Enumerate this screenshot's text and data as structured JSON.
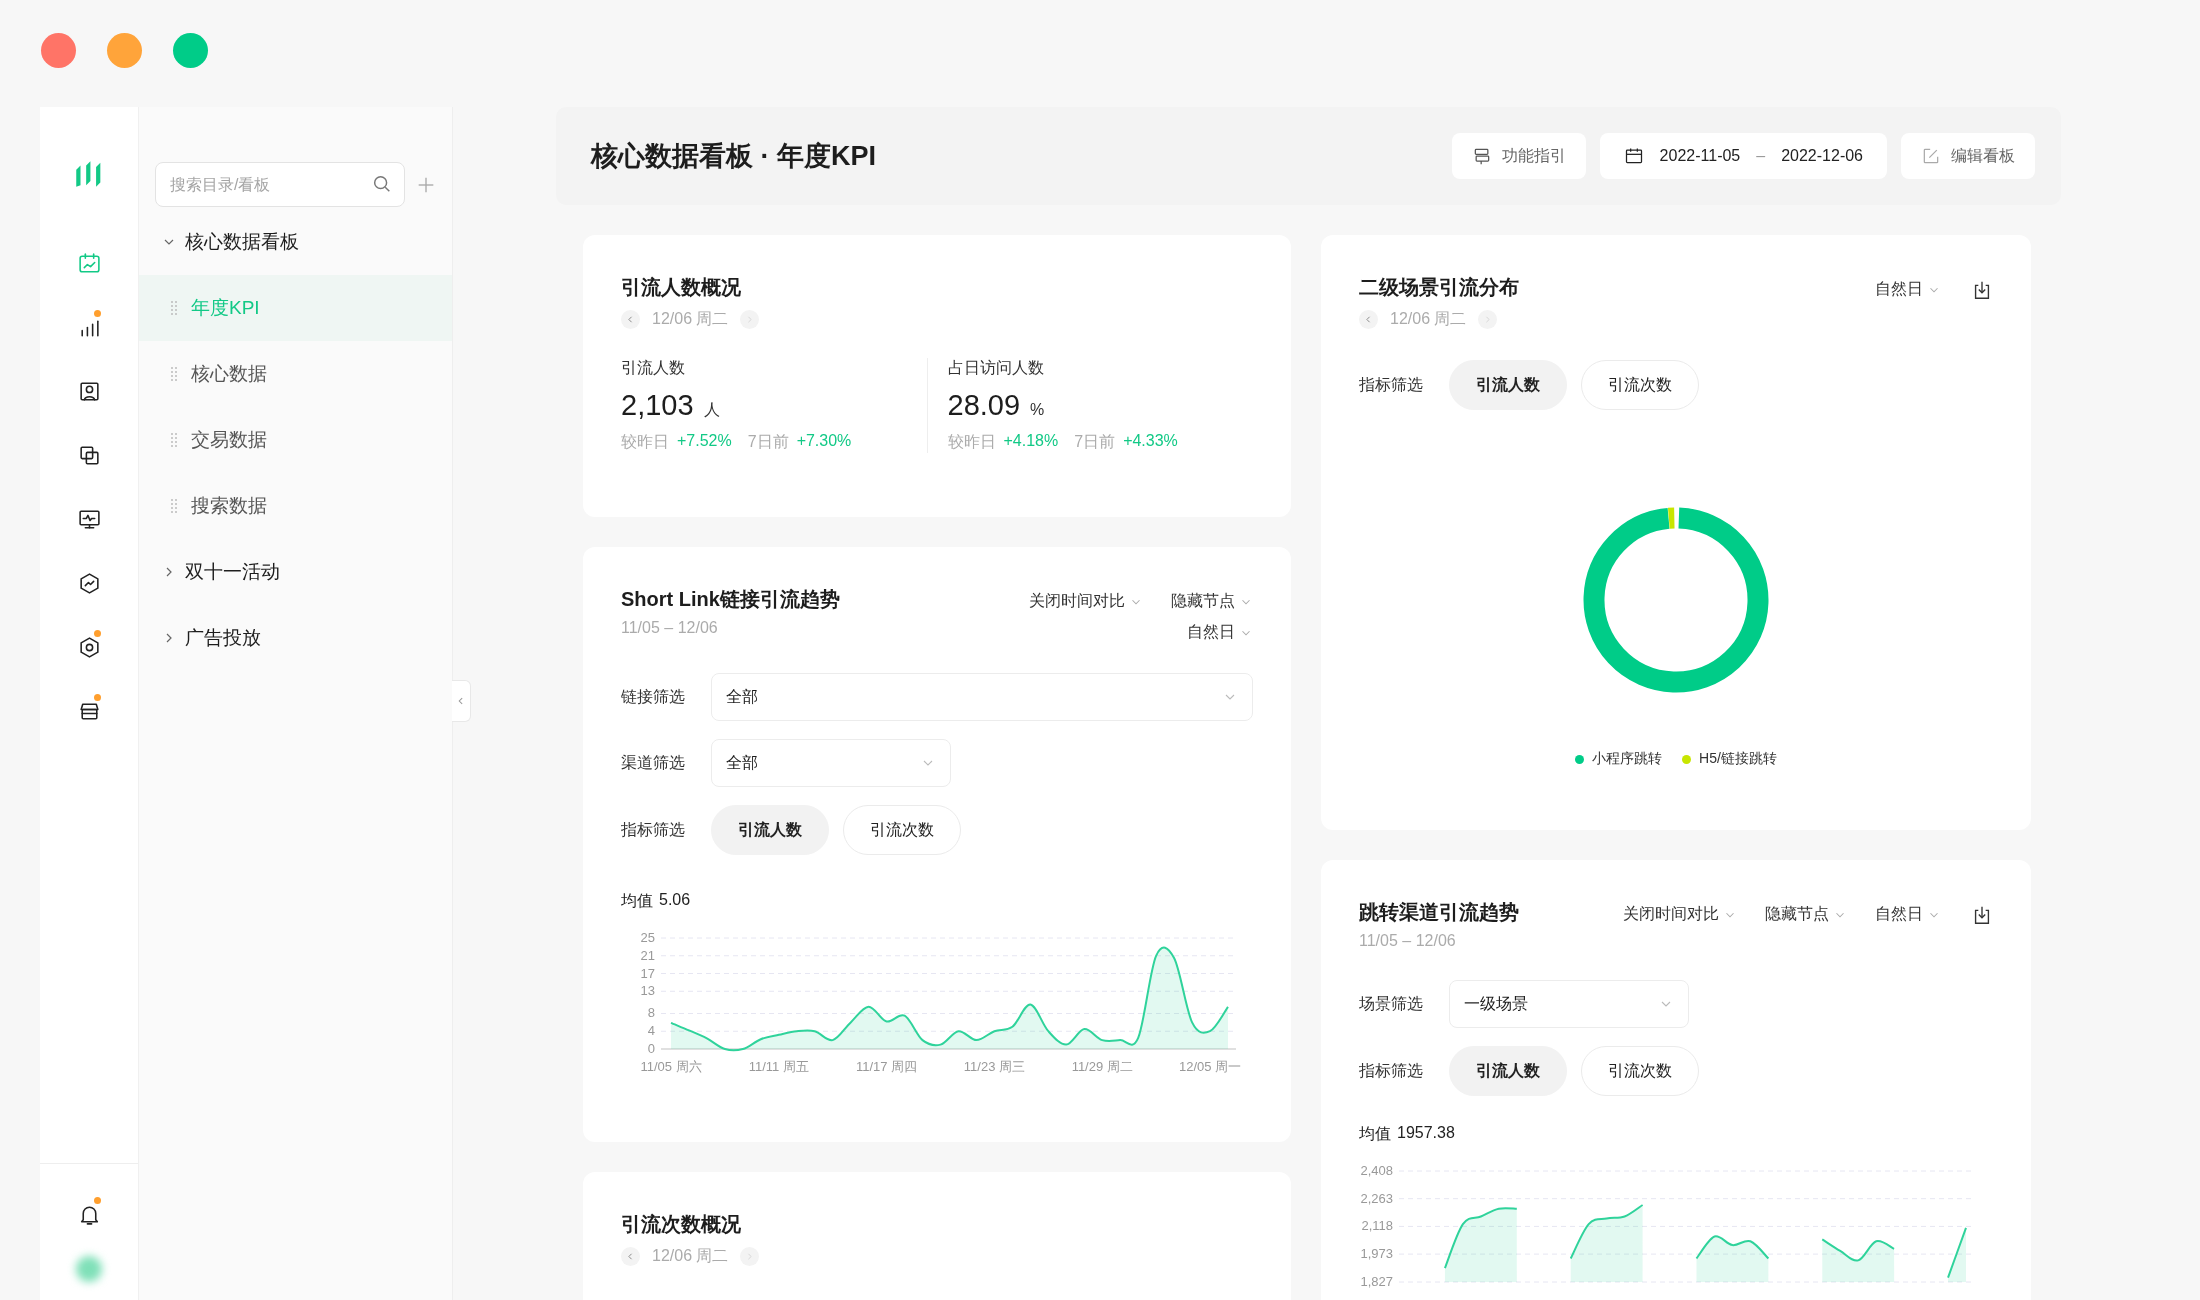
{
  "rail": {
    "items": [
      {
        "selected": true,
        "badge": false
      },
      {
        "selected": false,
        "badge": true
      },
      {
        "selected": false,
        "badge": false
      },
      {
        "selected": false,
        "badge": false
      },
      {
        "selected": false,
        "badge": false
      },
      {
        "selected": false,
        "badge": false
      },
      {
        "selected": false,
        "badge": true
      },
      {
        "selected": false,
        "badge": true
      }
    ],
    "notifications": {
      "badge": true
    }
  },
  "nav": {
    "search": {
      "placeholder": "搜索目录/看板"
    },
    "tree": [
      {
        "label": "核心数据看板",
        "expanded": true,
        "children": [
          {
            "label": "年度KPI",
            "selected": true
          },
          {
            "label": "核心数据",
            "selected": false
          },
          {
            "label": "交易数据",
            "selected": false
          },
          {
            "label": "搜索数据",
            "selected": false
          }
        ]
      },
      {
        "label": "双十一活动",
        "expanded": false
      },
      {
        "label": "广告投放",
        "expanded": false
      }
    ]
  },
  "header": {
    "title": "核心数据看板 · 年度KPI",
    "guide_button": "功能指引",
    "date_range": {
      "start": "2022-11-05",
      "separator": "–",
      "end": "2022-12-06"
    },
    "edit_button": "编辑看板"
  },
  "columns": [
    [
      {
        "title": "引流人数概况",
        "date_nav": {
          "text": "12/06 周二",
          "next_disabled": true
        },
        "metrics": [
          {
            "label": "引流人数",
            "value": "2,103",
            "unit": "人",
            "comparisons": [
              {
                "label": "较昨日",
                "delta": "+7.52%"
              },
              {
                "label": "7日前",
                "delta": "+7.30%"
              }
            ]
          },
          {
            "label": "占日访问人数",
            "value": "28.09",
            "unit": "%",
            "comparisons": [
              {
                "label": "较昨日",
                "delta": "+4.18%"
              },
              {
                "label": "7日前",
                "delta": "+4.33%"
              }
            ]
          }
        ]
      },
      {
        "title": "Short Link链接引流趋势",
        "range": "11/05 – 12/06",
        "controls": [
          "关闭时间对比",
          "隐藏节点",
          "自然日"
        ],
        "filters": [
          {
            "kind": "wide-select",
            "label": "链接筛选",
            "value": "全部"
          },
          {
            "kind": "select",
            "label": "渠道筛选",
            "value": "全部"
          },
          {
            "kind": "chips",
            "label": "指标筛选",
            "options": [
              {
                "label": "引流人数",
                "selected": true
              },
              {
                "label": "引流次数",
                "selected": false
              }
            ]
          }
        ],
        "average": {
          "label": "均值",
          "value": "5.06"
        },
        "chart_data": {
          "type": "area",
          "categories": [
            "11/05 周六",
            null,
            null,
            null,
            null,
            null,
            "11/11 周五",
            null,
            null,
            null,
            null,
            null,
            "11/17 周四",
            null,
            null,
            null,
            null,
            null,
            "11/23 周三",
            null,
            null,
            null,
            null,
            null,
            "11/29 周二",
            null,
            null,
            null,
            null,
            null,
            "12/05 周一",
            null
          ],
          "series": [
            {
              "color": "#2fd39b",
              "values": [
                5.9,
                4.2,
                2.4,
                0,
                0,
                2.2,
                3.2,
                4,
                4,
                2,
                6,
                9.5,
                6.2,
                7.5,
                2,
                1,
                4,
                2,
                4,
                5,
                10,
                4,
                1,
                4.5,
                2,
                2,
                2.5,
                21,
                20.5,
                6,
                4,
                9.5
              ]
            }
          ],
          "yticks": [
            0,
            4,
            8,
            13,
            17,
            21,
            25
          ],
          "ylim": [
            0,
            25
          ],
          "grid": true
        }
      },
      {
        "title": "引流次数概况",
        "date_nav": {
          "text": "12/06 周二",
          "next_disabled": true
        }
      }
    ],
    [
      {
        "title": "二级场景引流分布",
        "date_nav": {
          "text": "12/06 周二",
          "next_disabled": true
        },
        "controls": [
          "自然日"
        ],
        "download": true,
        "filters": [
          {
            "kind": "chips",
            "label": "指标筛选",
            "options": [
              {
                "label": "引流人数",
                "selected": true
              },
              {
                "label": "引流次数",
                "selected": false
              }
            ]
          }
        ],
        "donut": {
          "legend": [
            {
              "label": "小程序跳转",
              "color": "#00cc88"
            },
            {
              "label": "H5/链接跳转",
              "color": "#c8e600"
            }
          ]
        }
      },
      {
        "title": "跳转渠道引流趋势",
        "range": "11/05 – 12/06",
        "controls": [
          "关闭时间对比",
          "隐藏节点",
          "自然日"
        ],
        "download": true,
        "filters": [
          {
            "kind": "select",
            "label": "场景筛选",
            "value": "一级场景"
          },
          {
            "kind": "chips",
            "label": "指标筛选",
            "options": [
              {
                "label": "引流人数",
                "selected": true
              },
              {
                "label": "引流次数",
                "selected": false
              }
            ]
          }
        ],
        "average": {
          "label": "均值",
          "value": "1957.38"
        },
        "chart_data": {
          "type": "area",
          "series": [
            {
              "color": "#2fd39b",
              "values": [
                null,
                null,
                1900,
                2130,
                2170,
                2210,
                2210,
                null,
                null,
                1950,
                2130,
                2160,
                2170,
                2230,
                null,
                null,
                1950,
                2065,
                2020,
                2040,
                1950,
                null,
                null,
                2050,
                1990,
                1940,
                2040,
                2000,
                null,
                null,
                1850,
                2110
              ]
            }
          ],
          "yticks": [
            {
              "value": 1827,
              "label": "1,827"
            },
            {
              "value": 1973,
              "label": "1,973"
            },
            {
              "value": 2118,
              "label": "2,118"
            },
            {
              "value": 2263,
              "label": "2,263"
            },
            {
              "value": 2408,
              "label": "2,408"
            }
          ],
          "ylim": [
            1827,
            2408
          ],
          "grid": true
        }
      }
    ]
  ]
}
